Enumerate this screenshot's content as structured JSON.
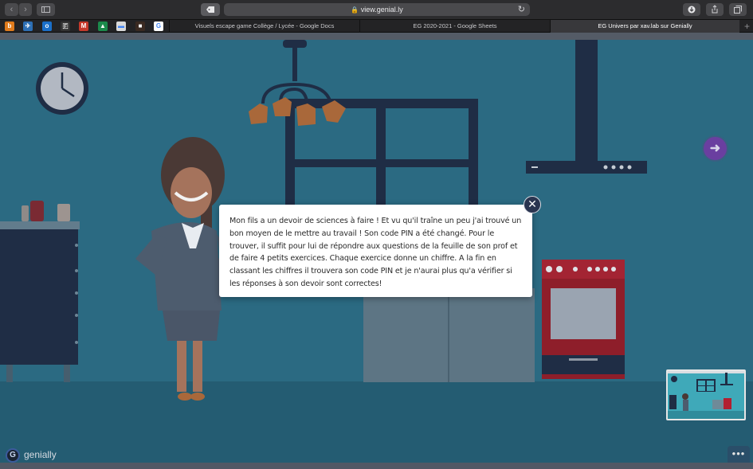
{
  "browser": {
    "url": "view.genial.ly",
    "icons": {
      "back": "chevron-left-icon",
      "forward": "chevron-right-icon",
      "sidebar": "sidebar-icon",
      "tag": "tag-icon",
      "lock": "lock-icon",
      "reload": "reload-icon",
      "download": "download-icon",
      "share": "share-icon",
      "tabs": "tabs-overview-icon"
    },
    "favorites": [
      {
        "name": "bookmark-fav-1",
        "color": "#e07b1c",
        "glyph": "b"
      },
      {
        "name": "bookmark-fav-2",
        "color": "#2d6fb4",
        "glyph": "✈"
      },
      {
        "name": "bookmark-outlook",
        "color": "#1a6fc9",
        "glyph": "o"
      },
      {
        "name": "bookmark-fav-4",
        "color": "#333333",
        "glyph": "🇫"
      },
      {
        "name": "bookmark-gmail",
        "color": "#c5392b",
        "glyph": "M"
      },
      {
        "name": "bookmark-drive",
        "color": "#1b8a4b",
        "glyph": "▲"
      },
      {
        "name": "bookmark-fav-7",
        "color": "#d9d9d9",
        "glyph": "▬"
      },
      {
        "name": "bookmark-fav-8",
        "color": "#3a2a22",
        "glyph": "■"
      },
      {
        "name": "bookmark-google",
        "color": "#ffffff",
        "glyph": "G"
      }
    ],
    "tabs": [
      {
        "label": "Visuels escape game Collège / Lycée - Google Docs",
        "active": false
      },
      {
        "label": "EG 2020-2021 - Google Sheets",
        "active": false
      },
      {
        "label": "EG Univers par xav.lab sur Genially",
        "active": true
      }
    ],
    "new_tab_glyph": "+"
  },
  "modal": {
    "text": "Mon fils a un devoir de sciences à faire ! Et vu qu'il traîne un peu j'ai trouvé un bon moyen de le mettre au travail ! Son code PIN a été changé. Pour le trouver, il suffit pour lui de répondre aux questions de la feuille de son prof et de faire 4 petits exercices. Chaque exercice donne un chiffre. A la fin en classant les chiffres il trouvera son code PIN et je n'aurai plus qu'a vérifier si les réponses à son devoir sont correctes!",
    "close_glyph": "✕"
  },
  "nav": {
    "next_glyph": "➜",
    "more_glyph": "•••"
  },
  "branding": {
    "logo_glyph": "G",
    "name": "genially"
  },
  "colors": {
    "stage_bg": "#2b6a82",
    "next_button": "#6a3fa0",
    "close_button": "#2a3550"
  }
}
